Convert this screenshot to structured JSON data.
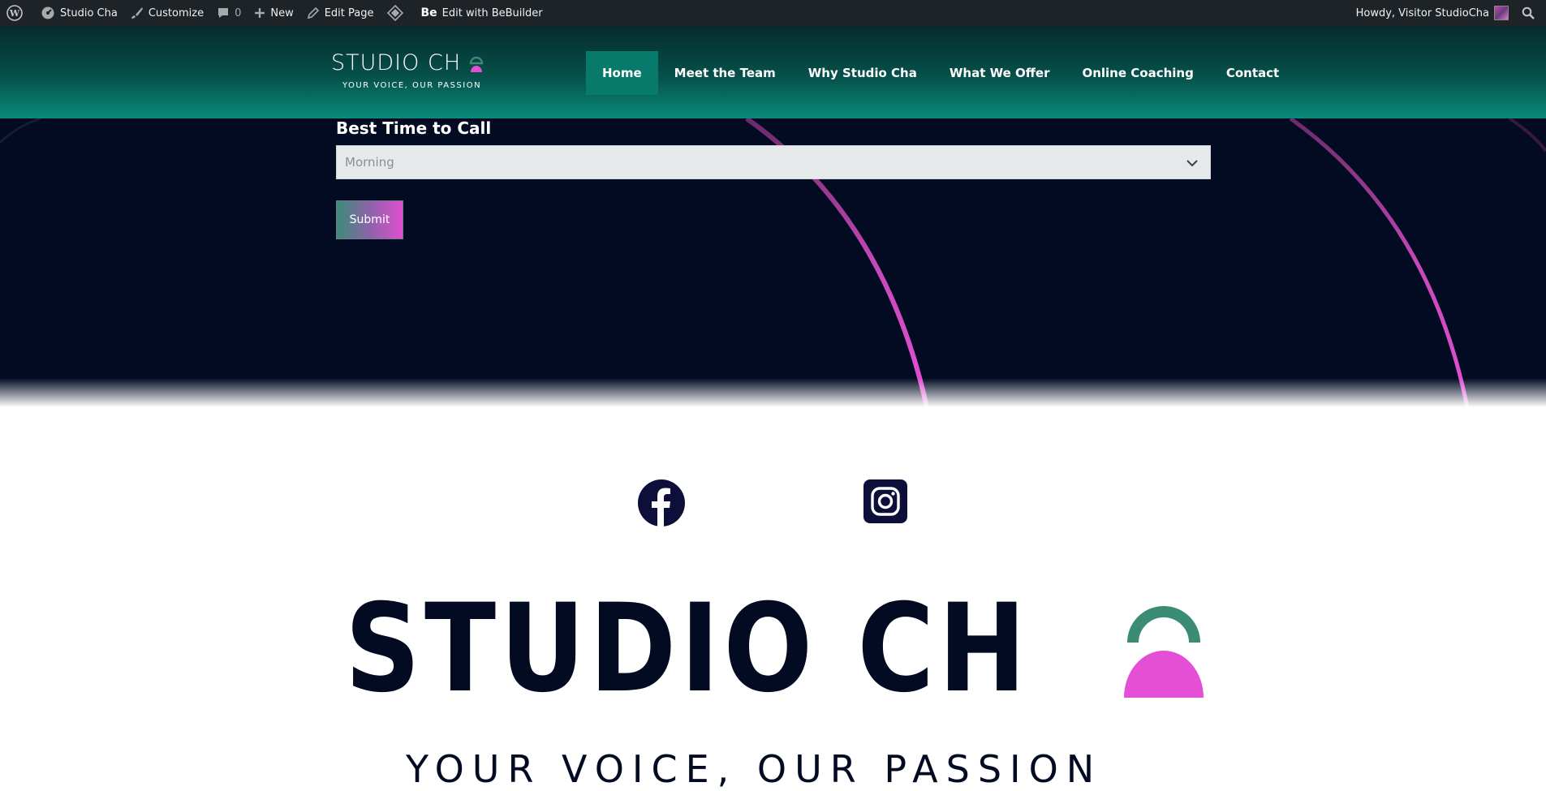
{
  "adminbar": {
    "site_name": "Studio Cha",
    "customize": "Customize",
    "comments_count": "0",
    "new": "New",
    "edit_page": "Edit Page",
    "bebuilder_badge": "Be",
    "edit_with": "Edit with BeBuilder",
    "howdy": "Howdy, Visitor StudioCha"
  },
  "header": {
    "logo_text": "STUDIO CH",
    "logo_tagline": "YOUR VOICE, OUR PASSION",
    "nav": [
      {
        "label": "Home",
        "active": true
      },
      {
        "label": "Meet the Team"
      },
      {
        "label": "Why Studio Cha"
      },
      {
        "label": "What We Offer"
      },
      {
        "label": "Online Coaching"
      },
      {
        "label": "Contact"
      }
    ]
  },
  "form": {
    "best_time_label": "Best Time to Call",
    "best_time_value": "Morning",
    "submit_label": "Submit"
  },
  "footer": {
    "big_logo_text": "STUDIO CH",
    "big_tagline": "YOUR VOICE, OUR PASSION"
  },
  "colors": {
    "dark_bg": "#020b22",
    "teal": "#087a6c",
    "pink": "#e54fd6",
    "green": "#3a8d74"
  }
}
